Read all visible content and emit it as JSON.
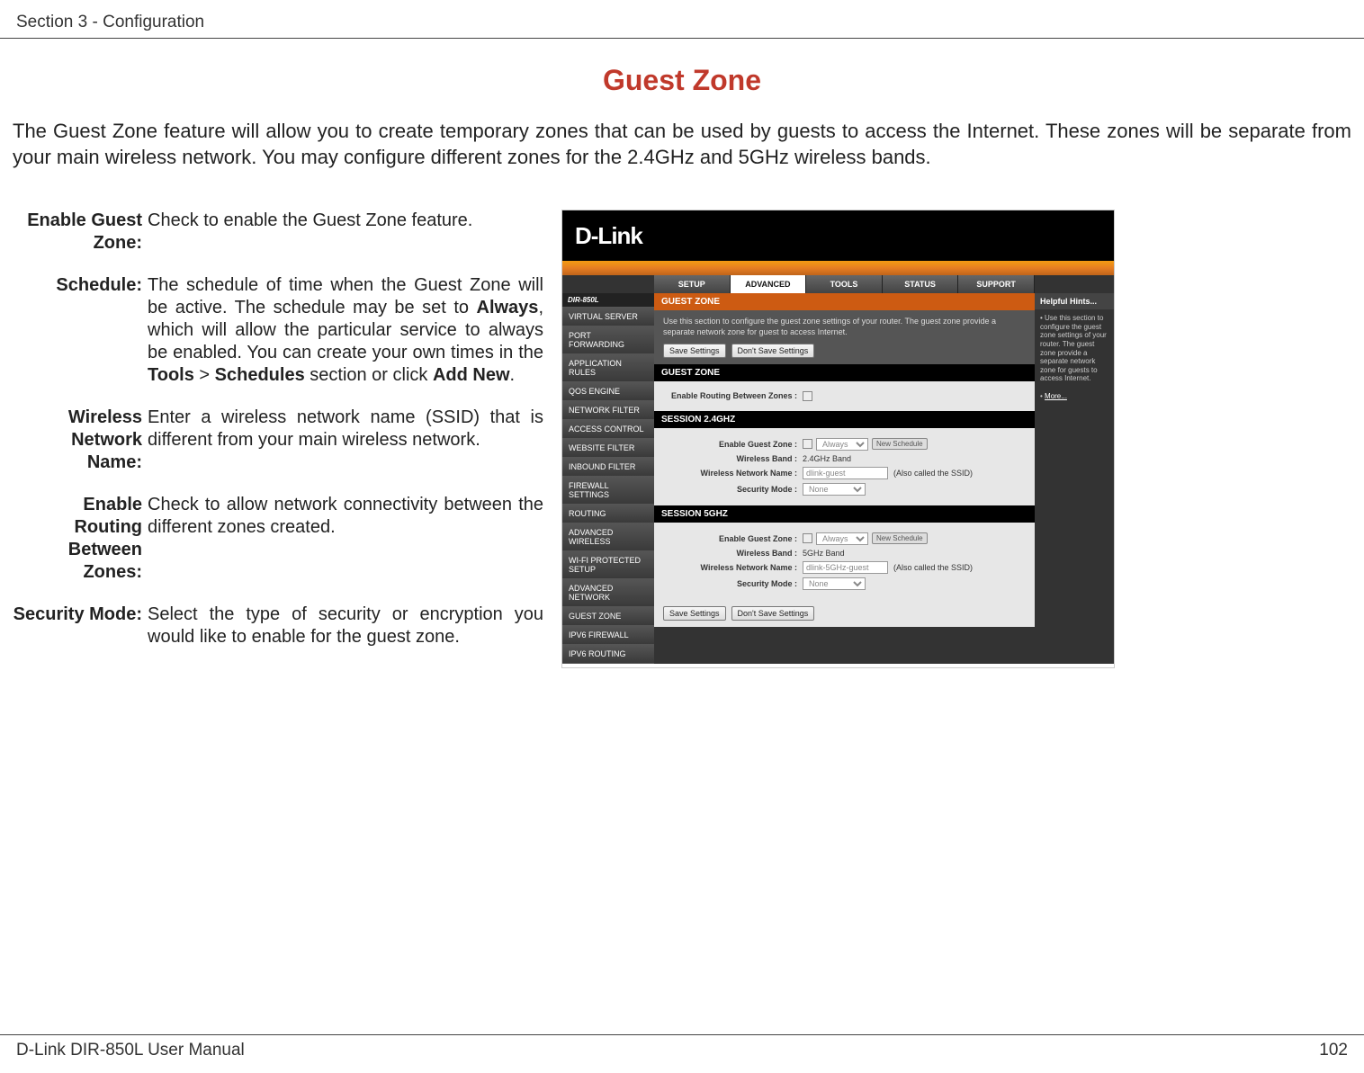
{
  "header": {
    "section": "Section 3 - Configuration"
  },
  "title": "Guest Zone",
  "intro": "The Guest Zone feature will allow you to create temporary zones that can be used by guests to access the Internet. These zones will be separate from your main wireless network. You may configure different zones for the 2.4GHz and 5GHz wireless bands.",
  "defs": {
    "enableGuest": {
      "label": "Enable Guest Zone:",
      "value": "Check to enable the Guest Zone feature."
    },
    "schedule": {
      "label": "Schedule:",
      "pre": "The schedule of time when the Guest Zone will be active. The schedule may be set to ",
      "b1": "Always",
      "mid1": ", which will allow the particular service to always be enabled. You can create your own times in the ",
      "b2": "Tools",
      "gt": " > ",
      "b3": "Schedules",
      "mid2": " section or click ",
      "b4": "Add New",
      "end": "."
    },
    "wname": {
      "label": "Wireless Network Name:",
      "value": "Enter a wireless network name (SSID) that is different from your main wireless network."
    },
    "routing": {
      "label": "Enable Routing Between Zones:",
      "value": "Check to allow network connectivity between the different zones created."
    },
    "security": {
      "label": "Security Mode:",
      "value": "Select the type of security or encryption you would like to enable for the guest zone."
    }
  },
  "router": {
    "brand": "D-Link",
    "device": "DIR-850L",
    "tabs": [
      "SETUP",
      "ADVANCED",
      "TOOLS",
      "STATUS",
      "SUPPORT"
    ],
    "nav": [
      "VIRTUAL SERVER",
      "PORT FORWARDING",
      "APPLICATION RULES",
      "QOS ENGINE",
      "NETWORK FILTER",
      "ACCESS CONTROL",
      "WEBSITE FILTER",
      "INBOUND FILTER",
      "FIREWALL SETTINGS",
      "ROUTING",
      "ADVANCED WIRELESS",
      "WI-FI PROTECTED SETUP",
      "ADVANCED NETWORK",
      "GUEST ZONE",
      "IPV6 FIREWALL",
      "IPV6 ROUTING"
    ],
    "blocks": {
      "intro_head": "GUEST ZONE",
      "intro_desc": "Use this section to configure the guest zone settings of your router. The guest zone provide a separate network zone for guest to access Internet.",
      "save": "Save Settings",
      "cancel": "Don't Save Settings",
      "gz_head": "GUEST ZONE",
      "gz_row": "Enable Routing Between Zones :",
      "s24_head": "SESSION 2.4GHZ",
      "s5_head": "SESSION 5GHZ",
      "row_enable": "Enable Guest Zone :",
      "row_band": "Wireless Band :",
      "band_24": "2.4GHz Band",
      "band_5": "5GHz Band",
      "row_wname": "Wireless Network Name :",
      "placeholder24": "dlink-guest",
      "placeholder5": "dlink-5GHz-guest",
      "ssid_note": "(Also called the SSID)",
      "row_sec": "Security Mode :",
      "sec_val": "None",
      "sched_always": "Always",
      "sched_new": "New Schedule"
    },
    "hints": {
      "head": "Helpful Hints...",
      "body": "Use this section to configure the guest zone settings of your router. The guest zone provide a separate network zone for guests to access Internet.",
      "more": "More..."
    }
  },
  "footer": {
    "left": "D-Link DIR-850L User Manual",
    "right": "102"
  }
}
